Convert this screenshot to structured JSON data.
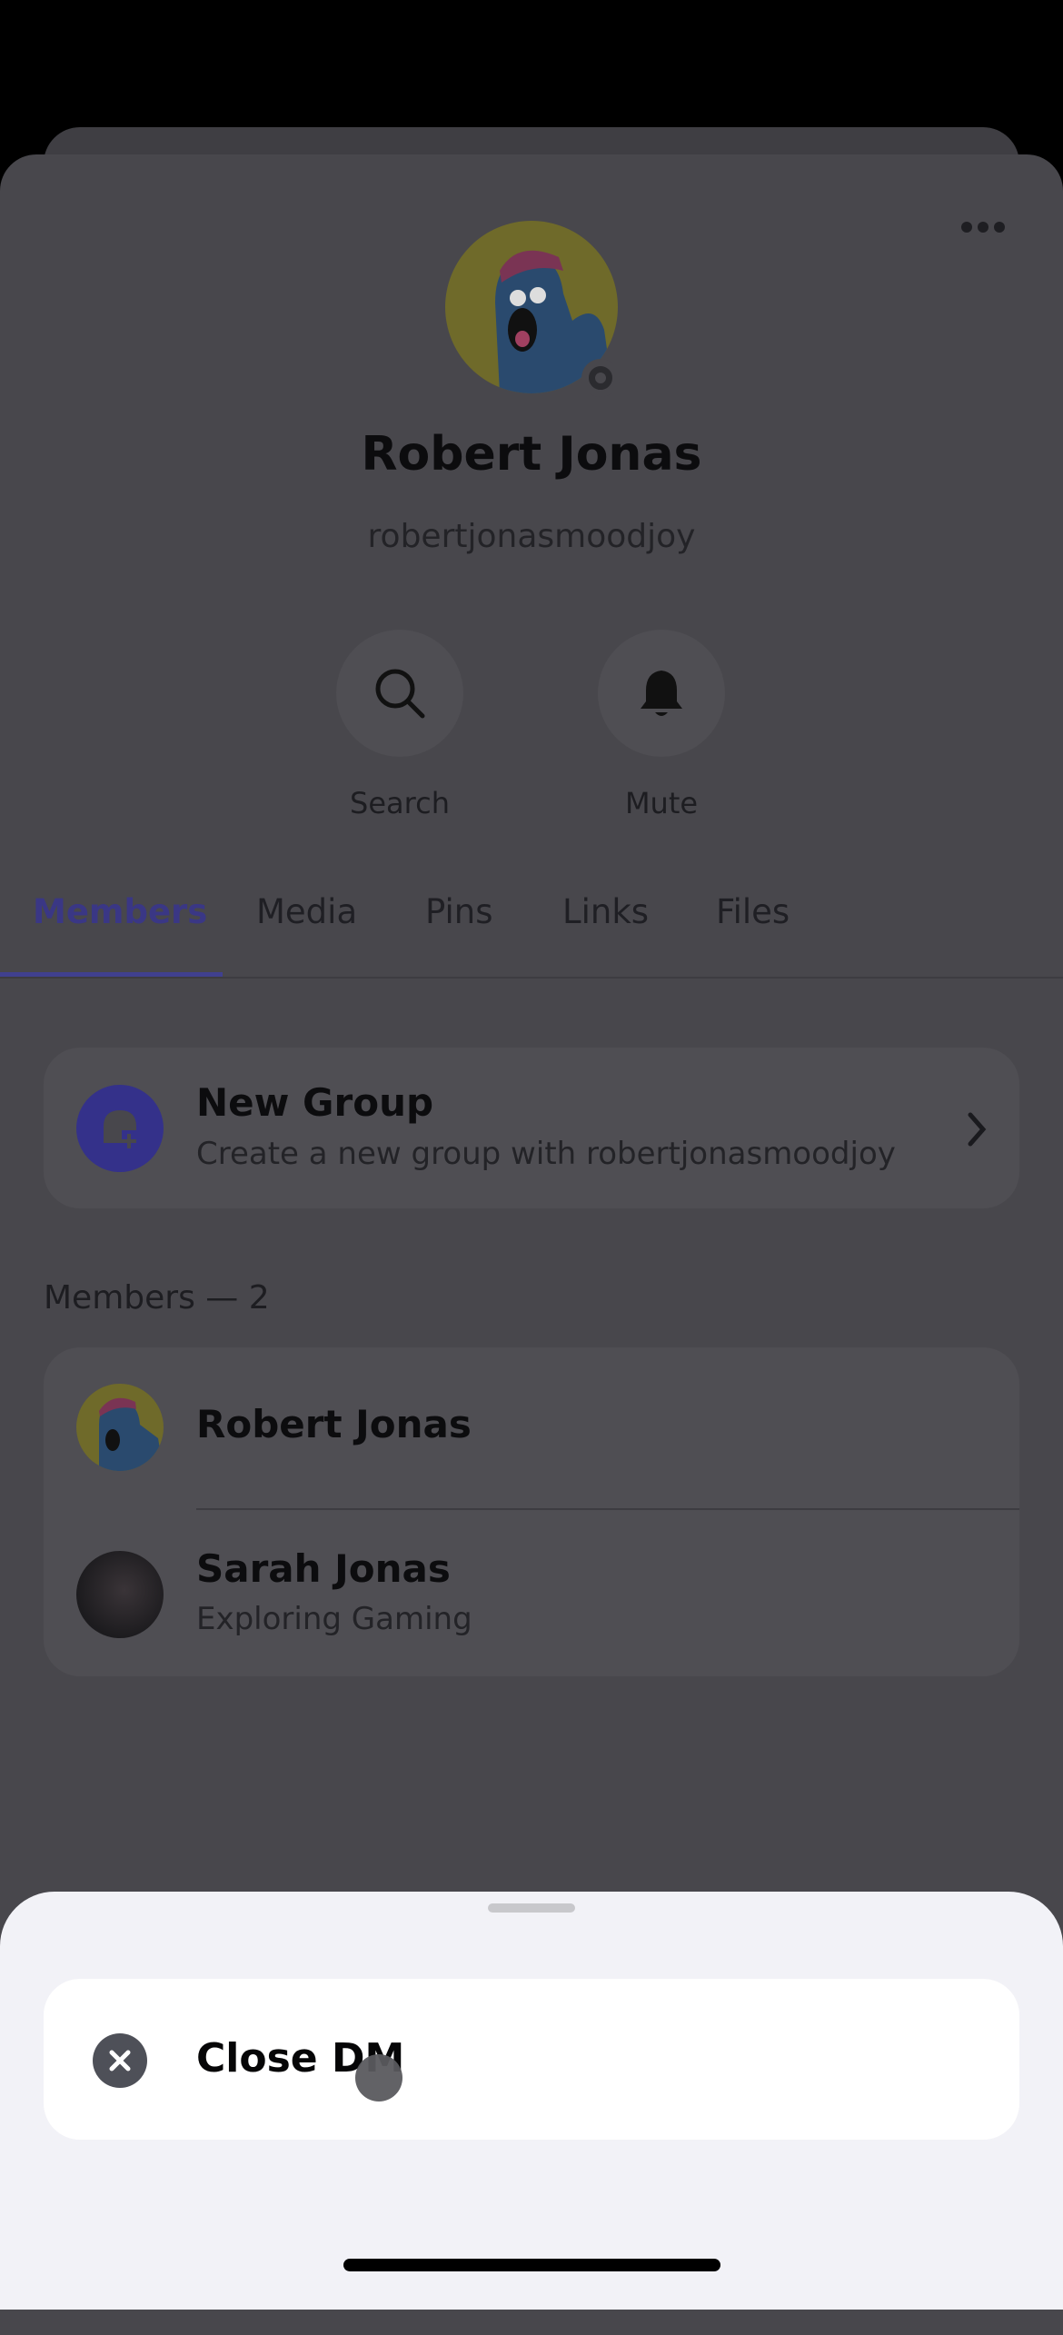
{
  "profile": {
    "display_name": "Robert Jonas",
    "username": "robertjonasmoodjoy",
    "status": "offline"
  },
  "actions": [
    {
      "label": "Search",
      "icon": "search-icon"
    },
    {
      "label": "Mute",
      "icon": "bell-icon"
    }
  ],
  "tabs": [
    {
      "label": "Members",
      "active": true
    },
    {
      "label": "Media"
    },
    {
      "label": "Pins"
    },
    {
      "label": "Links"
    },
    {
      "label": "Files"
    }
  ],
  "new_group": {
    "title": "New Group",
    "subtitle": "Create a new group with robertjonasmoodjoy"
  },
  "members": {
    "header": "Members — 2",
    "items": [
      {
        "name": "Robert Jonas",
        "status": ""
      },
      {
        "name": "Sarah Jonas",
        "status": "Exploring Gaming"
      }
    ]
  },
  "sheet": {
    "close_label": "Close DM"
  },
  "colors": {
    "accent": "#5865f2",
    "overlay_bg": "#48474c",
    "sheet_bg": "#f2f2f7"
  }
}
